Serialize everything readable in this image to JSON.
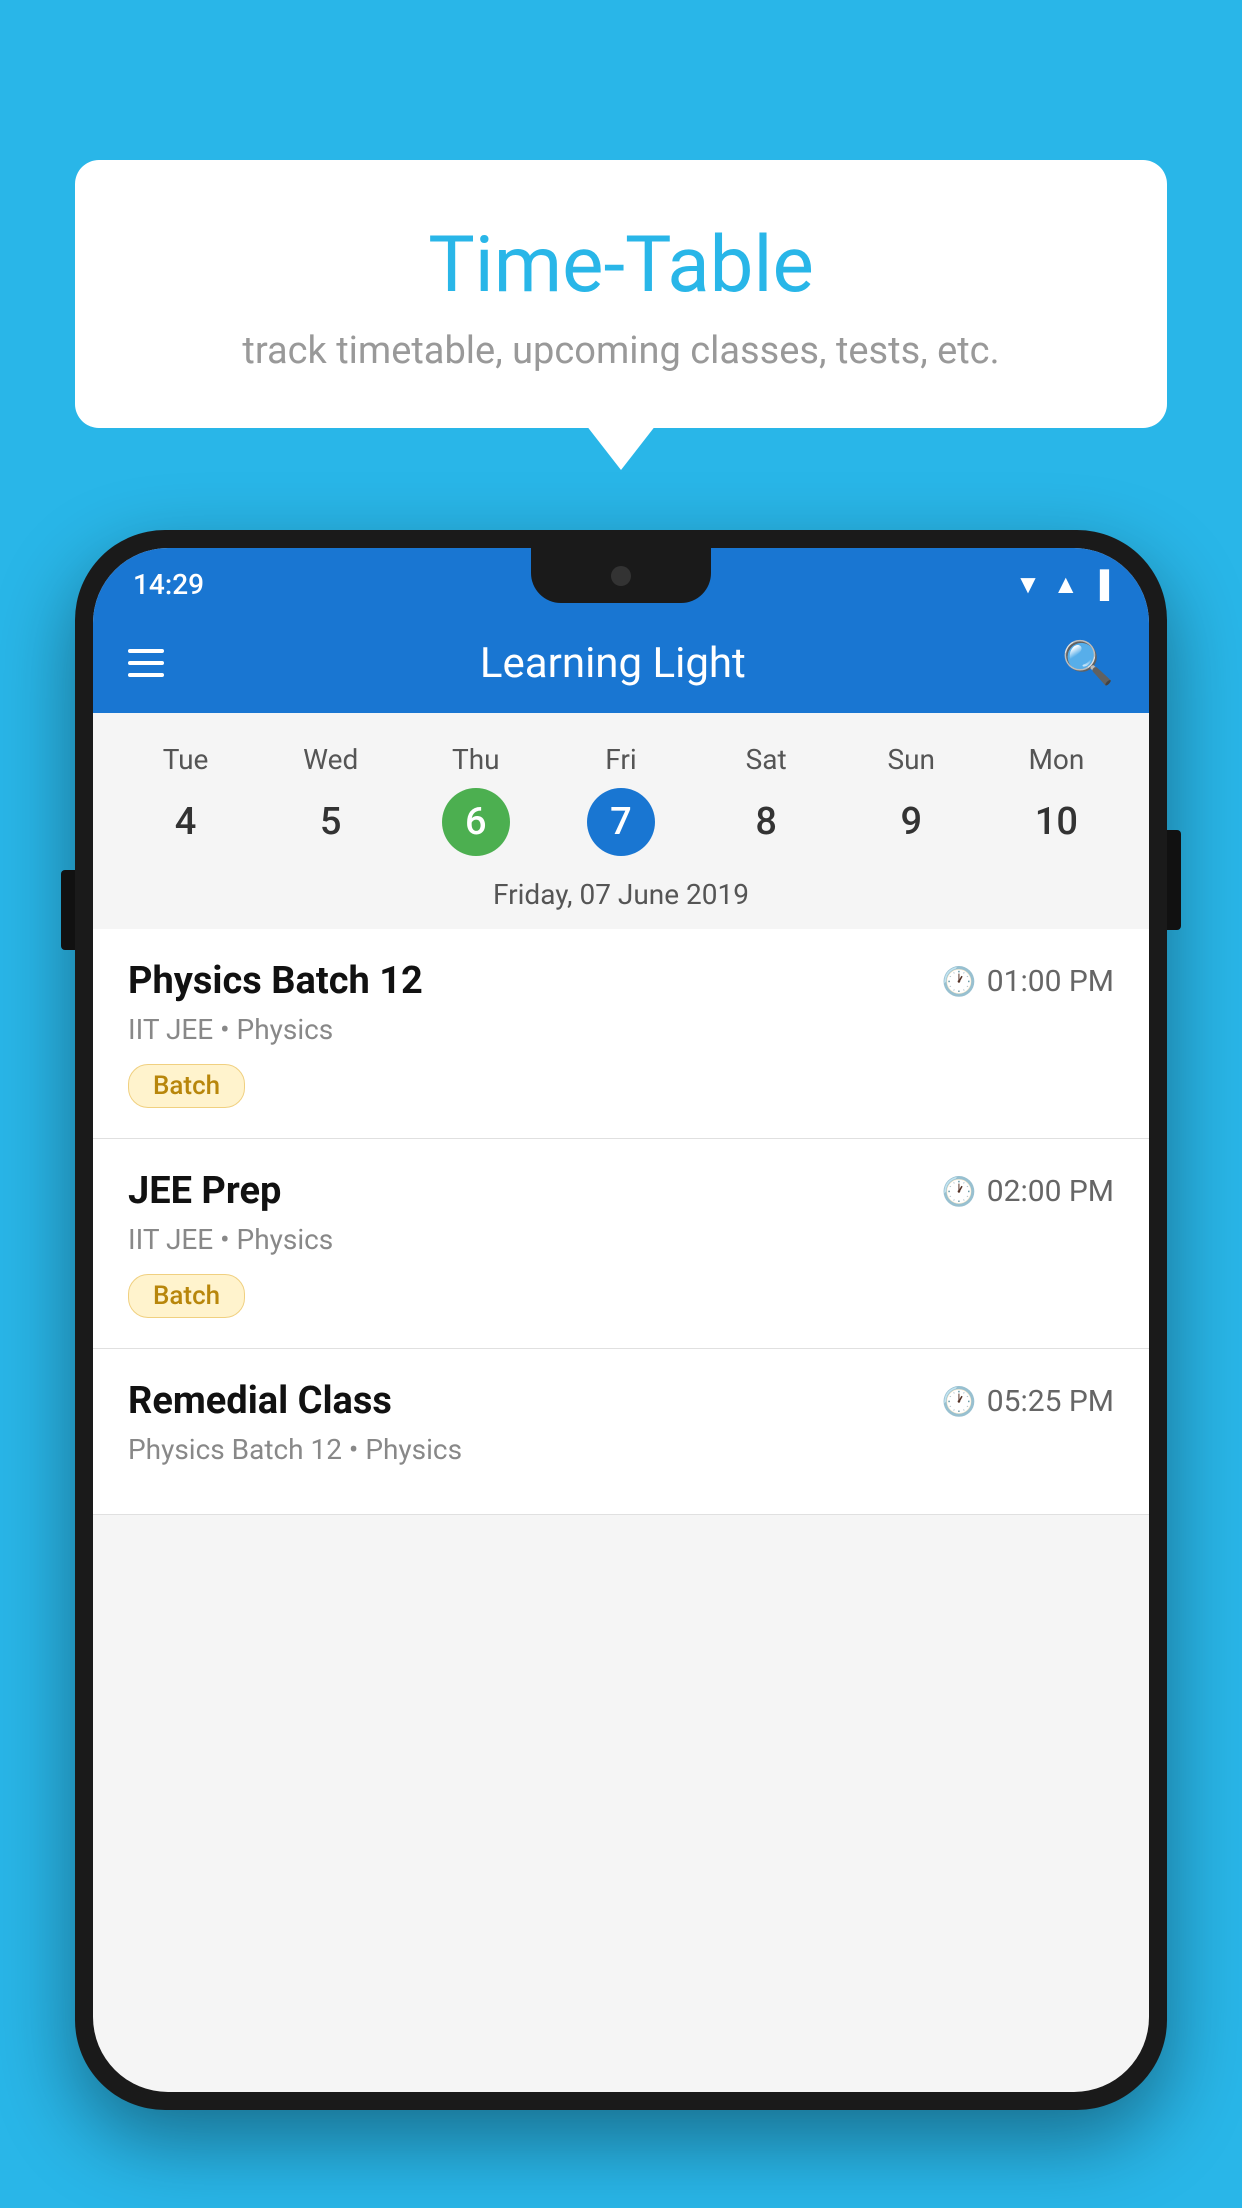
{
  "background": {
    "color": "#29b6e8"
  },
  "speech_bubble": {
    "title": "Time-Table",
    "subtitle": "track timetable, upcoming classes, tests, etc."
  },
  "status_bar": {
    "time": "14:29"
  },
  "app_bar": {
    "title": "Learning Light",
    "search_label": "search"
  },
  "calendar": {
    "days": [
      {
        "name": "Tue",
        "number": "4",
        "state": "normal"
      },
      {
        "name": "Wed",
        "number": "5",
        "state": "normal"
      },
      {
        "name": "Thu",
        "number": "6",
        "state": "today"
      },
      {
        "name": "Fri",
        "number": "7",
        "state": "selected"
      },
      {
        "name": "Sat",
        "number": "8",
        "state": "normal"
      },
      {
        "name": "Sun",
        "number": "9",
        "state": "normal"
      },
      {
        "name": "Mon",
        "number": "10",
        "state": "normal"
      }
    ],
    "selected_date_label": "Friday, 07 June 2019"
  },
  "classes": [
    {
      "name": "Physics Batch 12",
      "time": "01:00 PM",
      "detail": "IIT JEE • Physics",
      "badge": "Batch"
    },
    {
      "name": "JEE Prep",
      "time": "02:00 PM",
      "detail": "IIT JEE • Physics",
      "badge": "Batch"
    },
    {
      "name": "Remedial Class",
      "time": "05:25 PM",
      "detail": "Physics Batch 12 • Physics",
      "badge": ""
    }
  ]
}
